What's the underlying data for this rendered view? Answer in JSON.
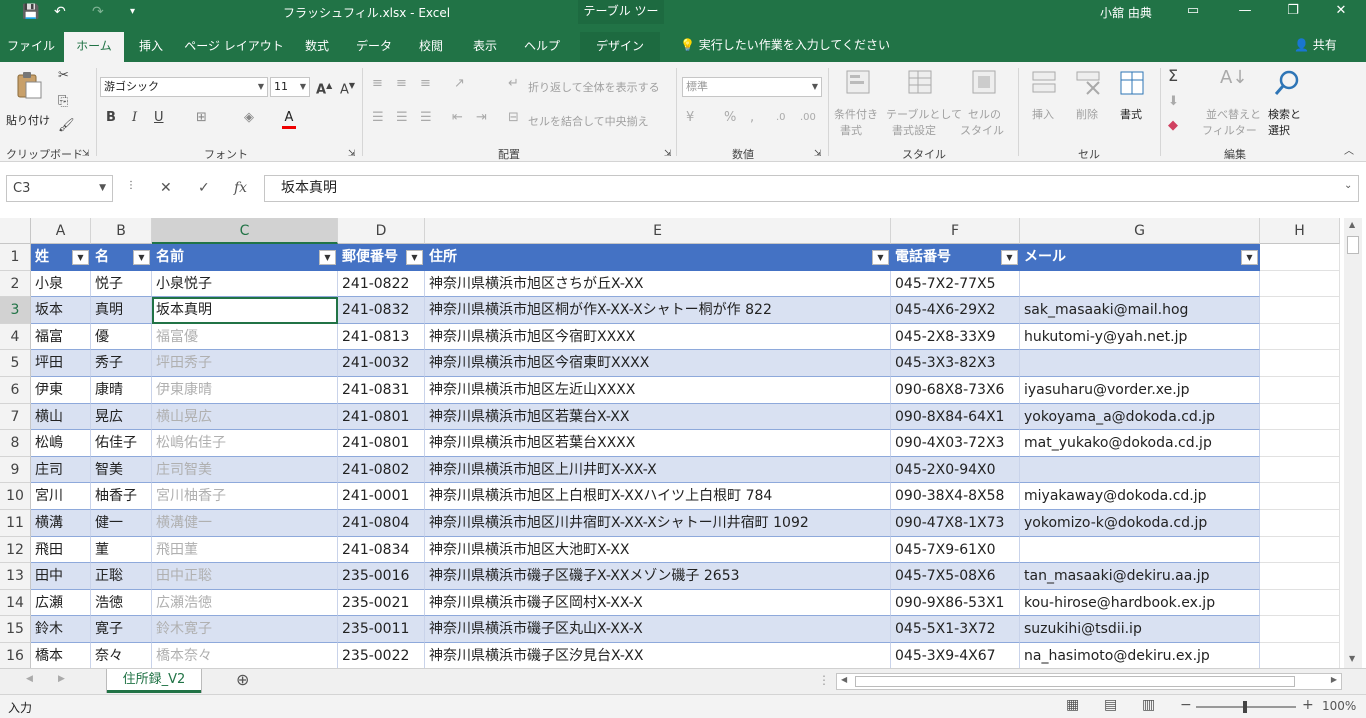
{
  "titlebar": {
    "filename": "フラッシュフィル.xlsx  -  Excel",
    "context_tab": "テーブル ツール",
    "user": "小舘 由典"
  },
  "tabs": [
    "ファイル",
    "ホーム",
    "挿入",
    "ページ レイアウト",
    "数式",
    "データ",
    "校閲",
    "表示",
    "ヘルプ",
    "デザイン"
  ],
  "tellme": "実行したい作業を入力してください",
  "share": "共有",
  "ribbon": {
    "clipboard": {
      "label": "クリップボード",
      "paste": "貼り付け"
    },
    "font": {
      "label": "フォント",
      "name": "游ゴシック",
      "size": "11"
    },
    "alignment": {
      "label": "配置",
      "wrap": "折り返して全体を表示する",
      "merge": "セルを結合して中央揃え"
    },
    "number": {
      "label": "数値",
      "format": "標準"
    },
    "styles": {
      "label": "スタイル",
      "conditional": [
        "条件付き",
        "書式"
      ],
      "table": [
        "テーブルとして",
        "書式設定"
      ],
      "cellstyle": [
        "セルの",
        "スタイル"
      ]
    },
    "cells": {
      "label": "セル",
      "insert": "挿入",
      "delete": "削除",
      "format": "書式"
    },
    "editing": {
      "label": "編集",
      "sort": [
        "並べ替えと",
        "フィルター"
      ],
      "find": [
        "検索と",
        "選択"
      ]
    }
  },
  "formulabar": {
    "namebox": "C3",
    "value": "坂本真明"
  },
  "grid": {
    "columns": [
      "A",
      "B",
      "C",
      "D",
      "E",
      "F",
      "G",
      "H"
    ],
    "header": [
      "姓",
      "名",
      "名前",
      "郵便番号",
      "住所",
      "電話番号",
      "メール"
    ],
    "rows": [
      [
        "小泉",
        "悦子",
        "小泉悦子",
        "241-0822",
        "神奈川県横浜市旭区さちが丘X-XX",
        "045-7X2-77X5",
        ""
      ],
      [
        "坂本",
        "真明",
        "坂本真明",
        "241-0832",
        "神奈川県横浜市旭区桐が作X-XX-Xシャトー桐が作 822",
        "045-4X6-29X2",
        "sak_masaaki@mail.hog"
      ],
      [
        "福富",
        "優",
        "福富優",
        "241-0813",
        "神奈川県横浜市旭区今宿町XXXX",
        "045-2X8-33X9",
        "hukutomi-y@yah.net.jp"
      ],
      [
        "坪田",
        "秀子",
        "坪田秀子",
        "241-0032",
        "神奈川県横浜市旭区今宿東町XXXX",
        "045-3X3-82X3",
        ""
      ],
      [
        "伊東",
        "康晴",
        "伊東康晴",
        "241-0831",
        "神奈川県横浜市旭区左近山XXXX",
        "090-68X8-73X6",
        "iyasuharu@vorder.xe.jp"
      ],
      [
        "横山",
        "晃広",
        "横山晃広",
        "241-0801",
        "神奈川県横浜市旭区若葉台X-XX",
        "090-8X84-64X1",
        "yokoyama_a@dokoda.cd.jp"
      ],
      [
        "松嶋",
        "佑佳子",
        "松嶋佑佳子",
        "241-0801",
        "神奈川県横浜市旭区若葉台XXXX",
        "090-4X03-72X3",
        "mat_yukako@dokoda.cd.jp"
      ],
      [
        "庄司",
        "智美",
        "庄司智美",
        "241-0802",
        "神奈川県横浜市旭区上川井町X-XX-X",
        "045-2X0-94X0",
        ""
      ],
      [
        "宮川",
        "柚香子",
        "宮川柚香子",
        "241-0001",
        "神奈川県横浜市旭区上白根町X-XXハイツ上白根町 784",
        "090-38X4-8X58",
        "miyakaway@dokoda.cd.jp"
      ],
      [
        "横溝",
        "健一",
        "横溝健一",
        "241-0804",
        "神奈川県横浜市旭区川井宿町X-XX-Xシャトー川井宿町 1092",
        "090-47X8-1X73",
        "yokomizo-k@dokoda.cd.jp"
      ],
      [
        "飛田",
        "菫",
        "飛田菫",
        "241-0834",
        "神奈川県横浜市旭区大池町X-XX",
        "045-7X9-61X0",
        ""
      ],
      [
        "田中",
        "正聡",
        "田中正聡",
        "235-0016",
        "神奈川県横浜市磯子区磯子X-XXメゾン磯子 2653",
        "045-7X5-08X6",
        "tan_masaaki@dekiru.aa.jp"
      ],
      [
        "広瀬",
        "浩徳",
        "広瀬浩徳",
        "235-0021",
        "神奈川県横浜市磯子区岡村X-XX-X",
        "090-9X86-53X1",
        "kou-hirose@hardbook.ex.jp"
      ],
      [
        "鈴木",
        "寛子",
        "鈴木寛子",
        "235-0011",
        "神奈川県横浜市磯子区丸山X-XX-X",
        "045-5X1-3X72",
        "suzukihi@tsdii.ip"
      ],
      [
        "橋本",
        "奈々",
        "橋本奈々",
        "235-0022",
        "神奈川県横浜市磯子区汐見台X-XX",
        "045-3X9-4X67",
        "na_hasimoto@dekiru.ex.jp"
      ]
    ]
  },
  "sheet": {
    "tab": "住所録_V2"
  },
  "status": {
    "mode": "入力",
    "zoom": "100%"
  }
}
